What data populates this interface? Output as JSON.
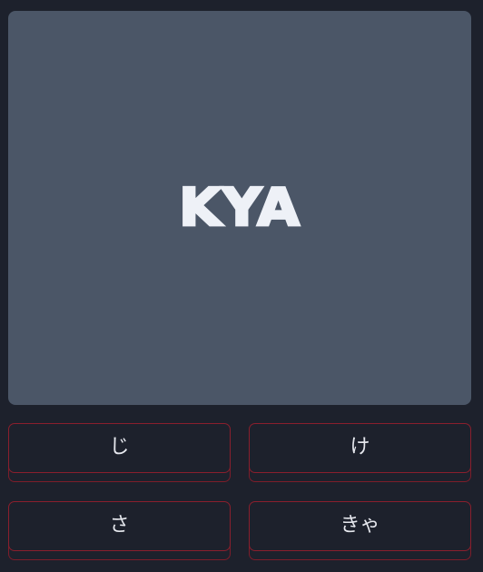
{
  "prompt": {
    "romaji": "KYA"
  },
  "answers": [
    {
      "label": "じ"
    },
    {
      "label": "け"
    },
    {
      "label": "さ"
    },
    {
      "label": "きゃ"
    }
  ],
  "colors": {
    "background": "#1d212c",
    "card": "#4b5667",
    "card_text": "#eef1f7",
    "answer_border": "#8a1f2d",
    "answer_text": "#e6e8ee"
  }
}
